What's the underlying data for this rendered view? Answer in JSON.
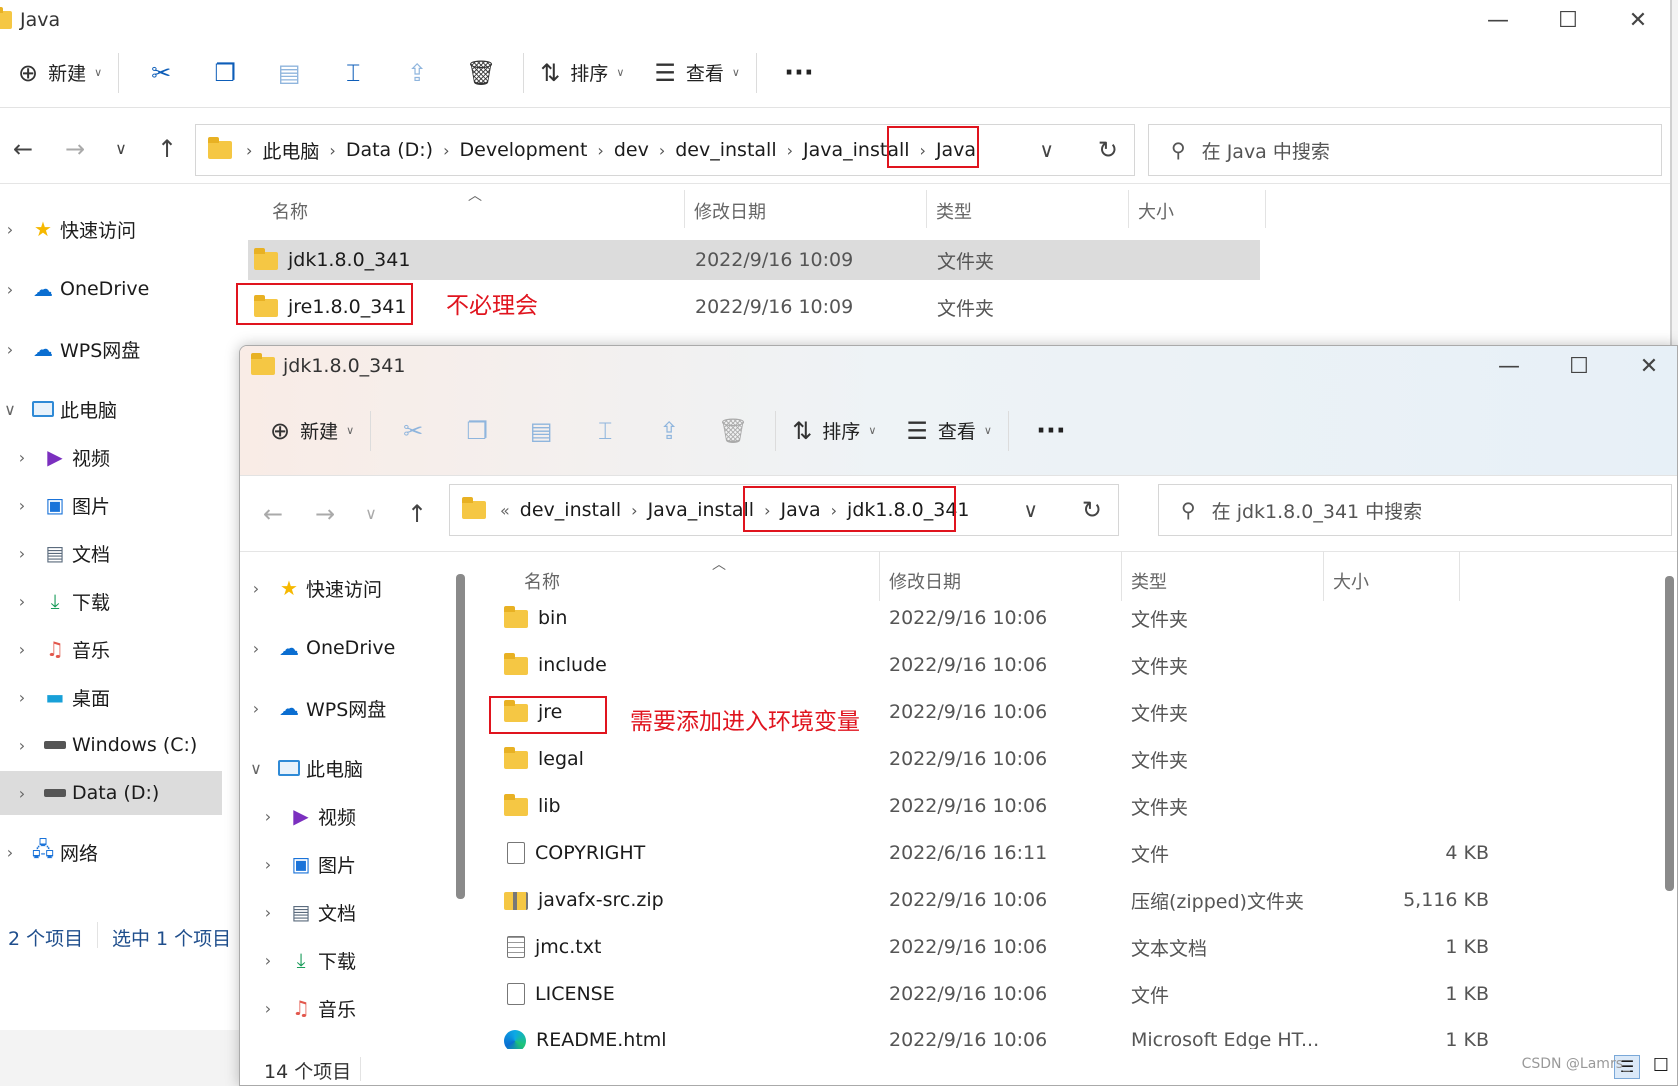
{
  "back": {
    "title": "Java",
    "toolbar": {
      "new_label": "新建",
      "sort_label": "排序",
      "view_label": "查看",
      "more": "···"
    },
    "breadcrumb": [
      "此电脑",
      "Data (D:)",
      "Development",
      "dev",
      "dev_install",
      "Java_install",
      "Java"
    ],
    "search_placeholder": "在 Java 中搜索",
    "columns": {
      "name": "名称",
      "date": "修改日期",
      "type": "类型",
      "size": "大小"
    },
    "sidebar": [
      {
        "label": "快速访问",
        "icon": "star-icon"
      },
      {
        "label": "OneDrive",
        "icon": "cloud-icon"
      },
      {
        "label": "WPS网盘",
        "icon": "cloud-icon"
      },
      {
        "label": "此电脑",
        "icon": "computer-icon"
      },
      {
        "label": "视频",
        "icon": "video-icon"
      },
      {
        "label": "图片",
        "icon": "picture-icon"
      },
      {
        "label": "文档",
        "icon": "document-icon"
      },
      {
        "label": "下载",
        "icon": "download-icon"
      },
      {
        "label": "音乐",
        "icon": "music-icon"
      },
      {
        "label": "桌面",
        "icon": "desktop-icon"
      },
      {
        "label": "Windows (C:)",
        "icon": "drive-icon"
      },
      {
        "label": "Data (D:)",
        "icon": "drive-icon"
      },
      {
        "label": "网络",
        "icon": "network-icon"
      }
    ],
    "files": [
      {
        "name": "jdk1.8.0_341",
        "date": "2022/9/16 10:09",
        "type": "文件夹"
      },
      {
        "name": "jre1.8.0_341",
        "date": "2022/9/16 10:09",
        "type": "文件夹"
      }
    ],
    "status": {
      "count": "2 个项目",
      "selected": "选中 1 个项目"
    },
    "annotation": "不必理会"
  },
  "front": {
    "title": "jdk1.8.0_341",
    "toolbar": {
      "new_label": "新建",
      "sort_label": "排序",
      "view_label": "查看",
      "more": "···"
    },
    "breadcrumb_prefix": "«",
    "breadcrumb": [
      "dev_install",
      "Java_install",
      "Java",
      "jdk1.8.0_341"
    ],
    "search_placeholder": "在 jdk1.8.0_341 中搜索",
    "columns": {
      "name": "名称",
      "date": "修改日期",
      "type": "类型",
      "size": "大小"
    },
    "sidebar": [
      {
        "label": "快速访问",
        "icon": "star-icon"
      },
      {
        "label": "OneDrive",
        "icon": "cloud-icon"
      },
      {
        "label": "WPS网盘",
        "icon": "cloud-icon"
      },
      {
        "label": "此电脑",
        "icon": "computer-icon"
      },
      {
        "label": "视频",
        "icon": "video-icon"
      },
      {
        "label": "图片",
        "icon": "picture-icon"
      },
      {
        "label": "文档",
        "icon": "document-icon"
      },
      {
        "label": "下载",
        "icon": "download-icon"
      },
      {
        "label": "音乐",
        "icon": "music-icon"
      }
    ],
    "files": [
      {
        "name": "bin",
        "date": "2022/9/16 10:06",
        "type": "文件夹",
        "size": "",
        "icon": "folder"
      },
      {
        "name": "include",
        "date": "2022/9/16 10:06",
        "type": "文件夹",
        "size": "",
        "icon": "folder"
      },
      {
        "name": "jre",
        "date": "2022/9/16 10:06",
        "type": "文件夹",
        "size": "",
        "icon": "folder"
      },
      {
        "name": "legal",
        "date": "2022/9/16 10:06",
        "type": "文件夹",
        "size": "",
        "icon": "folder"
      },
      {
        "name": "lib",
        "date": "2022/9/16 10:06",
        "type": "文件夹",
        "size": "",
        "icon": "folder"
      },
      {
        "name": "COPYRIGHT",
        "date": "2022/6/16 16:11",
        "type": "文件",
        "size": "4 KB",
        "icon": "file"
      },
      {
        "name": "javafx-src.zip",
        "date": "2022/9/16 10:06",
        "type": "压缩(zipped)文件夹",
        "size": "5,116 KB",
        "icon": "zip"
      },
      {
        "name": "jmc.txt",
        "date": "2022/9/16 10:06",
        "type": "文本文档",
        "size": "1 KB",
        "icon": "txt"
      },
      {
        "name": "LICENSE",
        "date": "2022/9/16 10:06",
        "type": "文件",
        "size": "1 KB",
        "icon": "file"
      },
      {
        "name": "README.html",
        "date": "2022/9/16 10:06",
        "type": "Microsoft Edge HT...",
        "size": "1 KB",
        "icon": "edge"
      }
    ],
    "status": {
      "count": "14 个项目"
    },
    "annotation": "需要添加进入环境变量"
  },
  "watermark": "CSDN @Lamrs_"
}
